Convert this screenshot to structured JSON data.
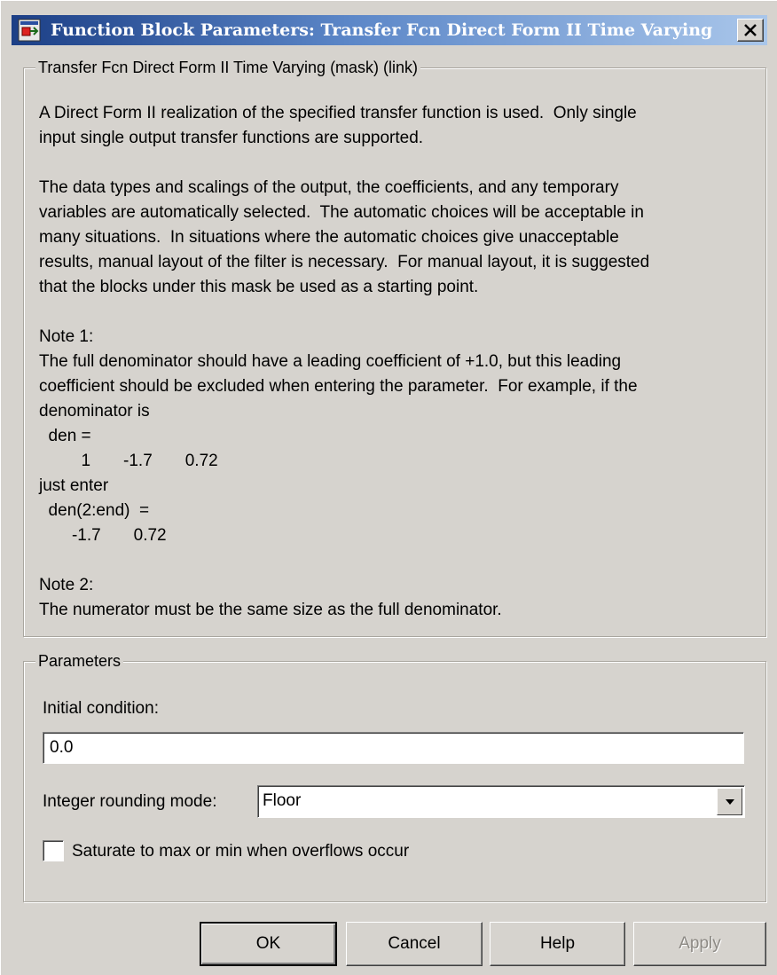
{
  "window": {
    "title": "Function Block Parameters: Transfer Fcn Direct Form II Time Varying",
    "icon": "simulink-block-icon",
    "close_icon": "close-x-icon"
  },
  "description": {
    "legend": "Transfer Fcn Direct Form II Time Varying (mask) (link)",
    "lines": [
      "A Direct Form II realization of the specified transfer function is used.  Only single",
      "input single output transfer functions are supported.",
      "",
      "The data types and scalings of the output, the coefficients, and any temporary",
      "variables are automatically selected.  The automatic choices will be acceptable in",
      "many situations.  In situations where the automatic choices give unacceptable",
      "results, manual layout of the filter is necessary.  For manual layout, it is suggested",
      "that the blocks under this mask be used as a starting point.",
      "",
      "Note 1:",
      "The full denominator should have a leading coefficient of +1.0, but this leading",
      "coefficient should be excluded when entering the parameter.  For example, if the",
      "denominator is",
      "  den =",
      "         1       -1.7       0.72",
      "just enter",
      "  den(2:end)  =",
      "       -1.7       0.72",
      "",
      "Note 2:",
      "The numerator must be the same size as the full denominator."
    ]
  },
  "parameters": {
    "legend": "Parameters",
    "initial_condition_label": "Initial condition:",
    "initial_condition_value": "0.0",
    "rounding_label": "Integer rounding mode:",
    "rounding_value": "Floor",
    "saturate_label": "Saturate to max or min when overflows occur",
    "saturate_checked": false
  },
  "buttons": {
    "ok": "OK",
    "cancel": "Cancel",
    "help": "Help",
    "apply": "Apply"
  }
}
